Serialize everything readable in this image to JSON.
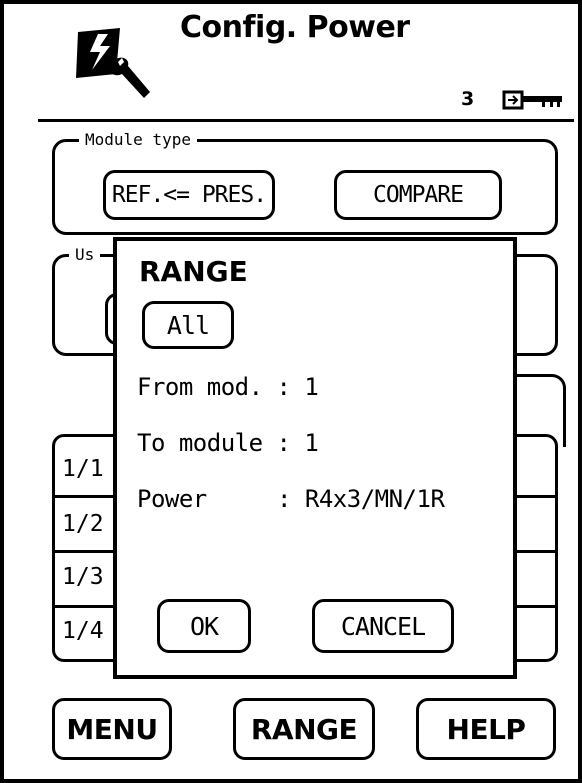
{
  "header": {
    "title": "Config. Power",
    "key_count": "3",
    "icons": [
      "config-power-icon",
      "key-icon"
    ]
  },
  "module_type": {
    "legend": "Module type",
    "ref_button": "REF.<= PRES.",
    "compare_button": "COMPARE"
  },
  "section2": {
    "legend_partial": "Us"
  },
  "rows": [
    "1/1",
    "1/2",
    "1/3",
    "1/4"
  ],
  "dialog": {
    "title": "RANGE",
    "all_button": "All",
    "from_label": "From mod. : 1",
    "to_label": "To module : 1",
    "power_label": "Power",
    "power_value": ": R4x3/MN/1R",
    "ok_button": "OK",
    "cancel_button": "CANCEL"
  },
  "footer": {
    "menu": "MENU",
    "range": "RANGE",
    "help": "HELP"
  }
}
